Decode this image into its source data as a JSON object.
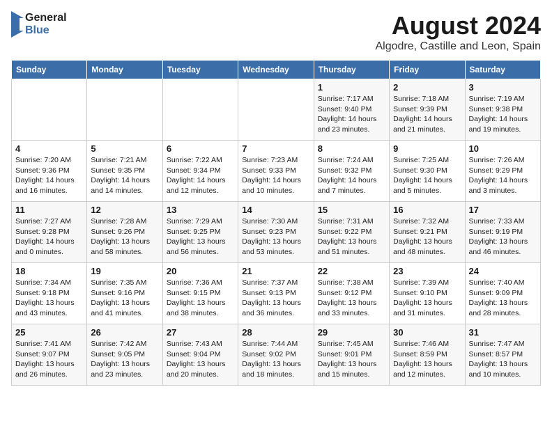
{
  "logo": {
    "line1": "General",
    "line2": "Blue"
  },
  "title": "August 2024",
  "subtitle": "Algodre, Castille and Leon, Spain",
  "weekdays": [
    "Sunday",
    "Monday",
    "Tuesday",
    "Wednesday",
    "Thursday",
    "Friday",
    "Saturday"
  ],
  "weeks": [
    [
      {
        "day": "",
        "info": ""
      },
      {
        "day": "",
        "info": ""
      },
      {
        "day": "",
        "info": ""
      },
      {
        "day": "",
        "info": ""
      },
      {
        "day": "1",
        "info": "Sunrise: 7:17 AM\nSunset: 9:40 PM\nDaylight: 14 hours\nand 23 minutes."
      },
      {
        "day": "2",
        "info": "Sunrise: 7:18 AM\nSunset: 9:39 PM\nDaylight: 14 hours\nand 21 minutes."
      },
      {
        "day": "3",
        "info": "Sunrise: 7:19 AM\nSunset: 9:38 PM\nDaylight: 14 hours\nand 19 minutes."
      }
    ],
    [
      {
        "day": "4",
        "info": "Sunrise: 7:20 AM\nSunset: 9:36 PM\nDaylight: 14 hours\nand 16 minutes."
      },
      {
        "day": "5",
        "info": "Sunrise: 7:21 AM\nSunset: 9:35 PM\nDaylight: 14 hours\nand 14 minutes."
      },
      {
        "day": "6",
        "info": "Sunrise: 7:22 AM\nSunset: 9:34 PM\nDaylight: 14 hours\nand 12 minutes."
      },
      {
        "day": "7",
        "info": "Sunrise: 7:23 AM\nSunset: 9:33 PM\nDaylight: 14 hours\nand 10 minutes."
      },
      {
        "day": "8",
        "info": "Sunrise: 7:24 AM\nSunset: 9:32 PM\nDaylight: 14 hours\nand 7 minutes."
      },
      {
        "day": "9",
        "info": "Sunrise: 7:25 AM\nSunset: 9:30 PM\nDaylight: 14 hours\nand 5 minutes."
      },
      {
        "day": "10",
        "info": "Sunrise: 7:26 AM\nSunset: 9:29 PM\nDaylight: 14 hours\nand 3 minutes."
      }
    ],
    [
      {
        "day": "11",
        "info": "Sunrise: 7:27 AM\nSunset: 9:28 PM\nDaylight: 14 hours\nand 0 minutes."
      },
      {
        "day": "12",
        "info": "Sunrise: 7:28 AM\nSunset: 9:26 PM\nDaylight: 13 hours\nand 58 minutes."
      },
      {
        "day": "13",
        "info": "Sunrise: 7:29 AM\nSunset: 9:25 PM\nDaylight: 13 hours\nand 56 minutes."
      },
      {
        "day": "14",
        "info": "Sunrise: 7:30 AM\nSunset: 9:23 PM\nDaylight: 13 hours\nand 53 minutes."
      },
      {
        "day": "15",
        "info": "Sunrise: 7:31 AM\nSunset: 9:22 PM\nDaylight: 13 hours\nand 51 minutes."
      },
      {
        "day": "16",
        "info": "Sunrise: 7:32 AM\nSunset: 9:21 PM\nDaylight: 13 hours\nand 48 minutes."
      },
      {
        "day": "17",
        "info": "Sunrise: 7:33 AM\nSunset: 9:19 PM\nDaylight: 13 hours\nand 46 minutes."
      }
    ],
    [
      {
        "day": "18",
        "info": "Sunrise: 7:34 AM\nSunset: 9:18 PM\nDaylight: 13 hours\nand 43 minutes."
      },
      {
        "day": "19",
        "info": "Sunrise: 7:35 AM\nSunset: 9:16 PM\nDaylight: 13 hours\nand 41 minutes."
      },
      {
        "day": "20",
        "info": "Sunrise: 7:36 AM\nSunset: 9:15 PM\nDaylight: 13 hours\nand 38 minutes."
      },
      {
        "day": "21",
        "info": "Sunrise: 7:37 AM\nSunset: 9:13 PM\nDaylight: 13 hours\nand 36 minutes."
      },
      {
        "day": "22",
        "info": "Sunrise: 7:38 AM\nSunset: 9:12 PM\nDaylight: 13 hours\nand 33 minutes."
      },
      {
        "day": "23",
        "info": "Sunrise: 7:39 AM\nSunset: 9:10 PM\nDaylight: 13 hours\nand 31 minutes."
      },
      {
        "day": "24",
        "info": "Sunrise: 7:40 AM\nSunset: 9:09 PM\nDaylight: 13 hours\nand 28 minutes."
      }
    ],
    [
      {
        "day": "25",
        "info": "Sunrise: 7:41 AM\nSunset: 9:07 PM\nDaylight: 13 hours\nand 26 minutes."
      },
      {
        "day": "26",
        "info": "Sunrise: 7:42 AM\nSunset: 9:05 PM\nDaylight: 13 hours\nand 23 minutes."
      },
      {
        "day": "27",
        "info": "Sunrise: 7:43 AM\nSunset: 9:04 PM\nDaylight: 13 hours\nand 20 minutes."
      },
      {
        "day": "28",
        "info": "Sunrise: 7:44 AM\nSunset: 9:02 PM\nDaylight: 13 hours\nand 18 minutes."
      },
      {
        "day": "29",
        "info": "Sunrise: 7:45 AM\nSunset: 9:01 PM\nDaylight: 13 hours\nand 15 minutes."
      },
      {
        "day": "30",
        "info": "Sunrise: 7:46 AM\nSunset: 8:59 PM\nDaylight: 13 hours\nand 12 minutes."
      },
      {
        "day": "31",
        "info": "Sunrise: 7:47 AM\nSunset: 8:57 PM\nDaylight: 13 hours\nand 10 minutes."
      }
    ]
  ]
}
